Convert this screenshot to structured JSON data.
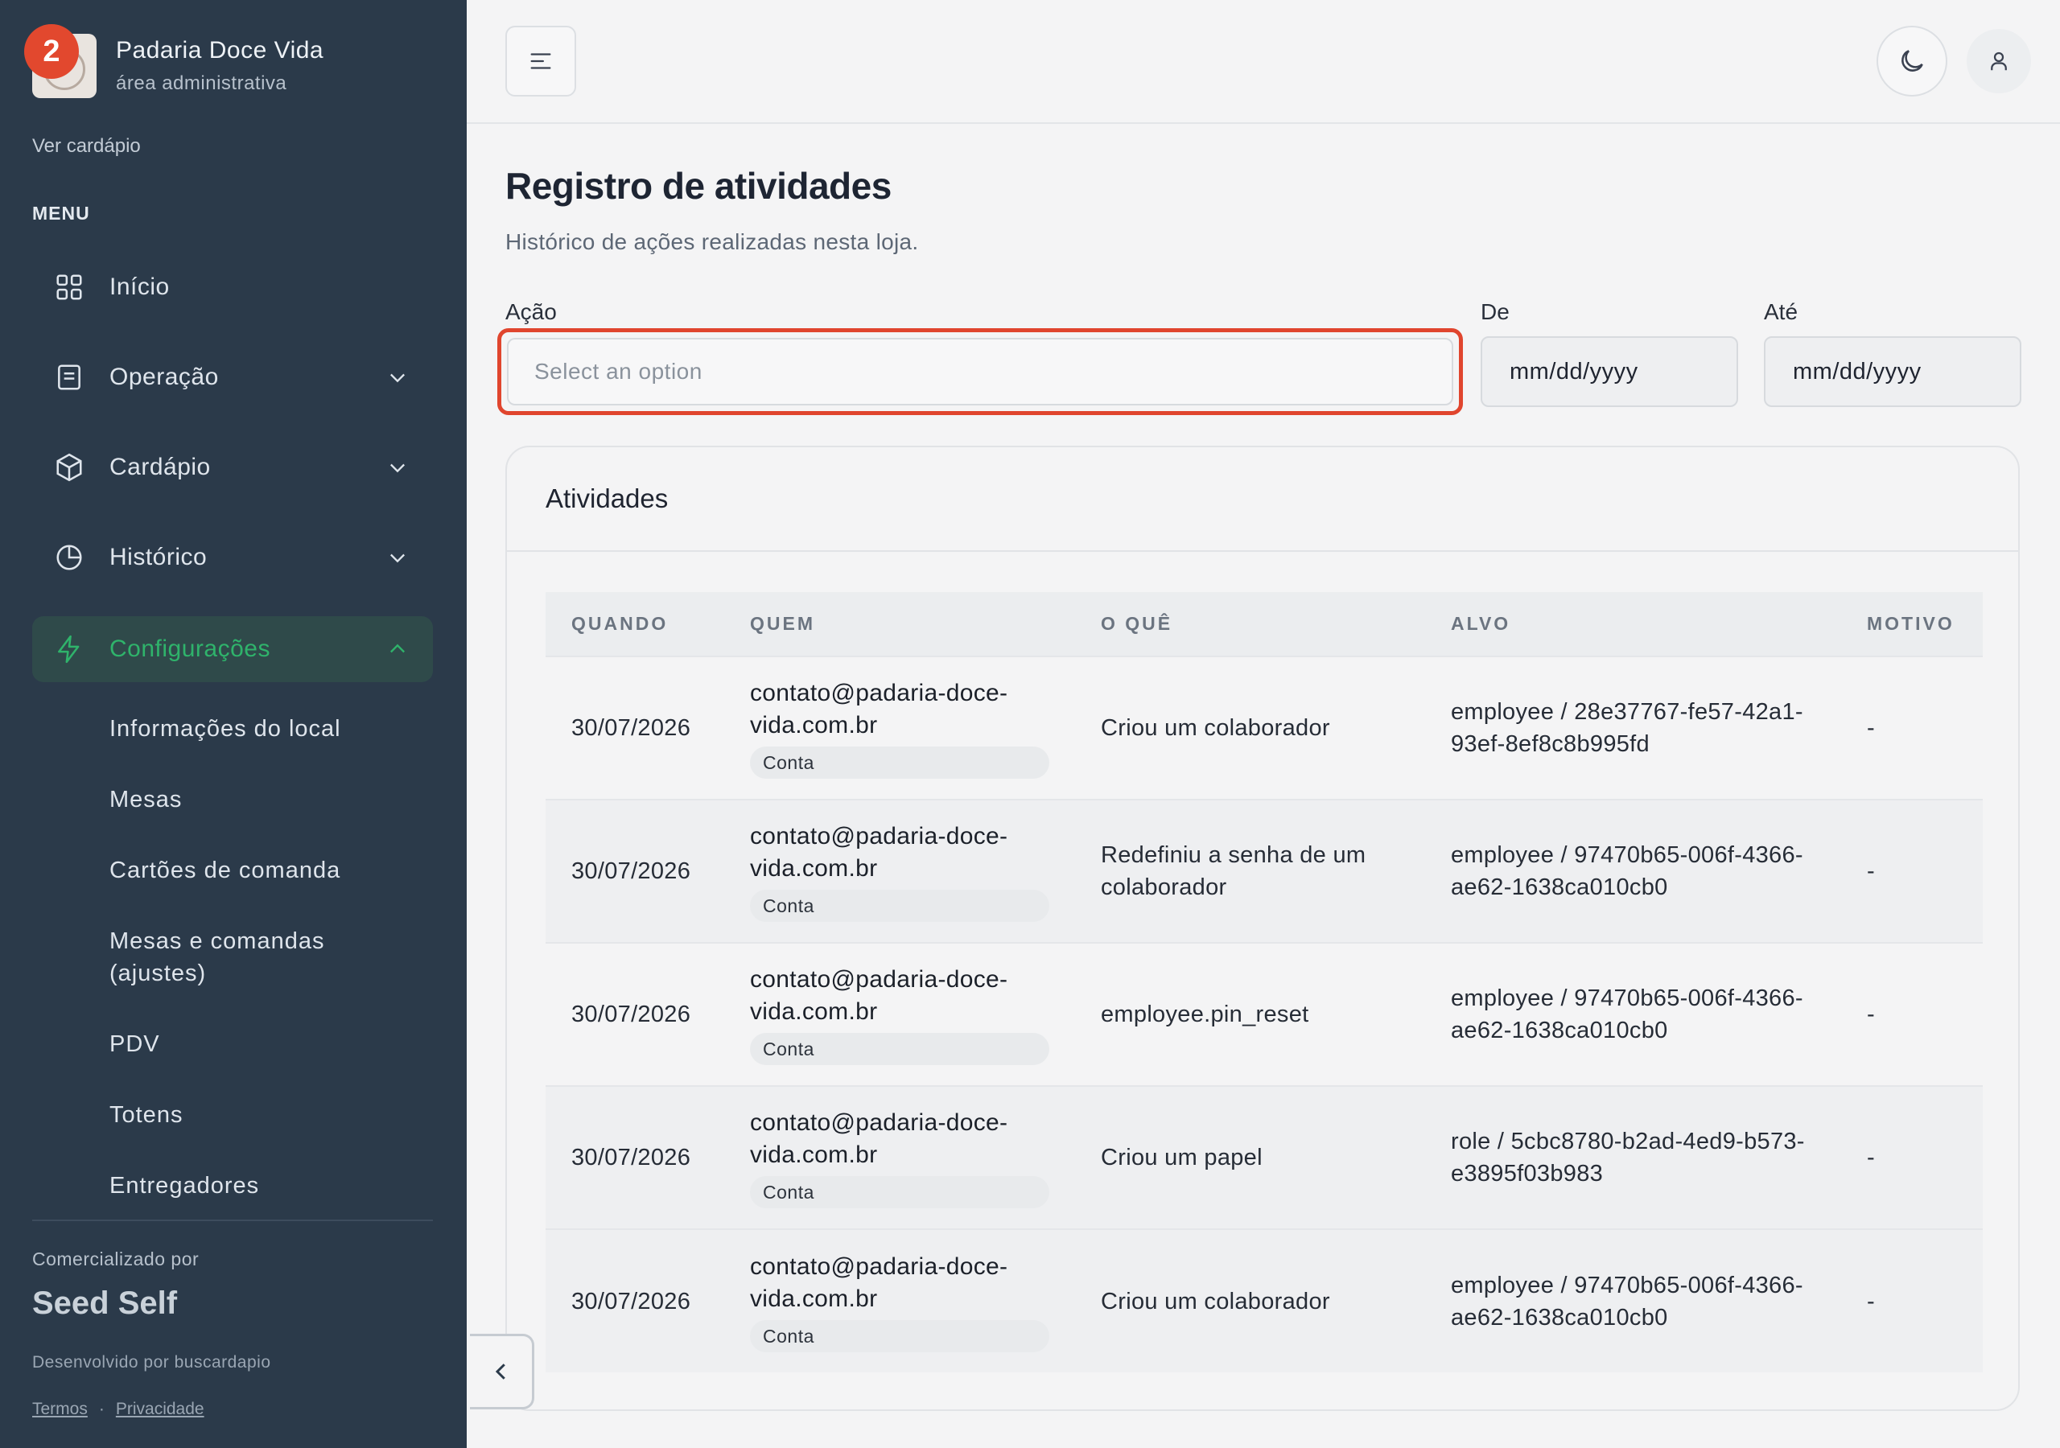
{
  "brand": {
    "name": "Padaria Doce Vida",
    "subtitle": "área administrativa",
    "notification_count": "2",
    "view_menu_link": "Ver cardápio"
  },
  "sidebar": {
    "menu_label": "MENU",
    "items": [
      {
        "label": "Início",
        "icon": "grid-icon"
      },
      {
        "label": "Operação",
        "icon": "clipboard-icon"
      },
      {
        "label": "Cardápio",
        "icon": "box-icon"
      },
      {
        "label": "Histórico",
        "icon": "pie-chart-icon"
      },
      {
        "label": "Configurações",
        "icon": "lightning-icon",
        "active": true
      }
    ],
    "subitems": [
      "Informações do local",
      "Mesas",
      "Cartões de comanda",
      "Mesas e comandas (ajustes)",
      "PDV",
      "Totens",
      "Entregadores"
    ],
    "footer": {
      "commercialized_by": "Comercializado por",
      "company": "Seed Self",
      "developed_by": "Desenvolvido por buscardapio",
      "terms": "Termos",
      "separator": "·",
      "privacy": "Privacidade"
    }
  },
  "page": {
    "title": "Registro de atividades",
    "subtitle": "Histórico de ações realizadas nesta loja."
  },
  "filters": {
    "action_label": "Ação",
    "action_placeholder": "Select an option",
    "from_label": "De",
    "from_value": "mm/dd/yyyy",
    "to_label": "Até",
    "to_value": "mm/dd/yyyy"
  },
  "activities": {
    "card_title": "Atividades",
    "columns": [
      "QUANDO",
      "QUEM",
      "O QUÊ",
      "ALVO",
      "MOTIVO"
    ],
    "rows": [
      {
        "when": "30/07/2026",
        "who": "contato@padaria-doce-vida.com.br",
        "who_tag": "Conta",
        "what": "Criou um colaborador",
        "target": "employee / 28e37767-fe57-42a1-93ef-8ef8c8b995fd",
        "reason": "-"
      },
      {
        "when": "30/07/2026",
        "who": "contato@padaria-doce-vida.com.br",
        "who_tag": "Conta",
        "what": "Redefiniu a senha de um colaborador",
        "target": "employee / 97470b65-006f-4366-ae62-1638ca010cb0",
        "reason": "-"
      },
      {
        "when": "30/07/2026",
        "who": "contato@padaria-doce-vida.com.br",
        "who_tag": "Conta",
        "what": "employee.pin_reset",
        "target": "employee / 97470b65-006f-4366-ae62-1638ca010cb0",
        "reason": "-"
      },
      {
        "when": "30/07/2026",
        "who": "contato@padaria-doce-vida.com.br",
        "who_tag": "Conta",
        "what": "Criou um papel",
        "target": "role / 5cbc8780-b2ad-4ed9-b573-e3895f03b983",
        "reason": "-"
      },
      {
        "when": "30/07/2026",
        "who": "contato@padaria-doce-vida.com.br",
        "who_tag": "Conta",
        "what": "Criou um colaborador",
        "target": "employee / 97470b65-006f-4366-ae62-1638ca010cb0",
        "reason": "-"
      }
    ]
  },
  "colors": {
    "sidebar_bg": "#2b3a4a",
    "accent_green": "#2fb36b",
    "highlight_red": "#e0452e"
  }
}
